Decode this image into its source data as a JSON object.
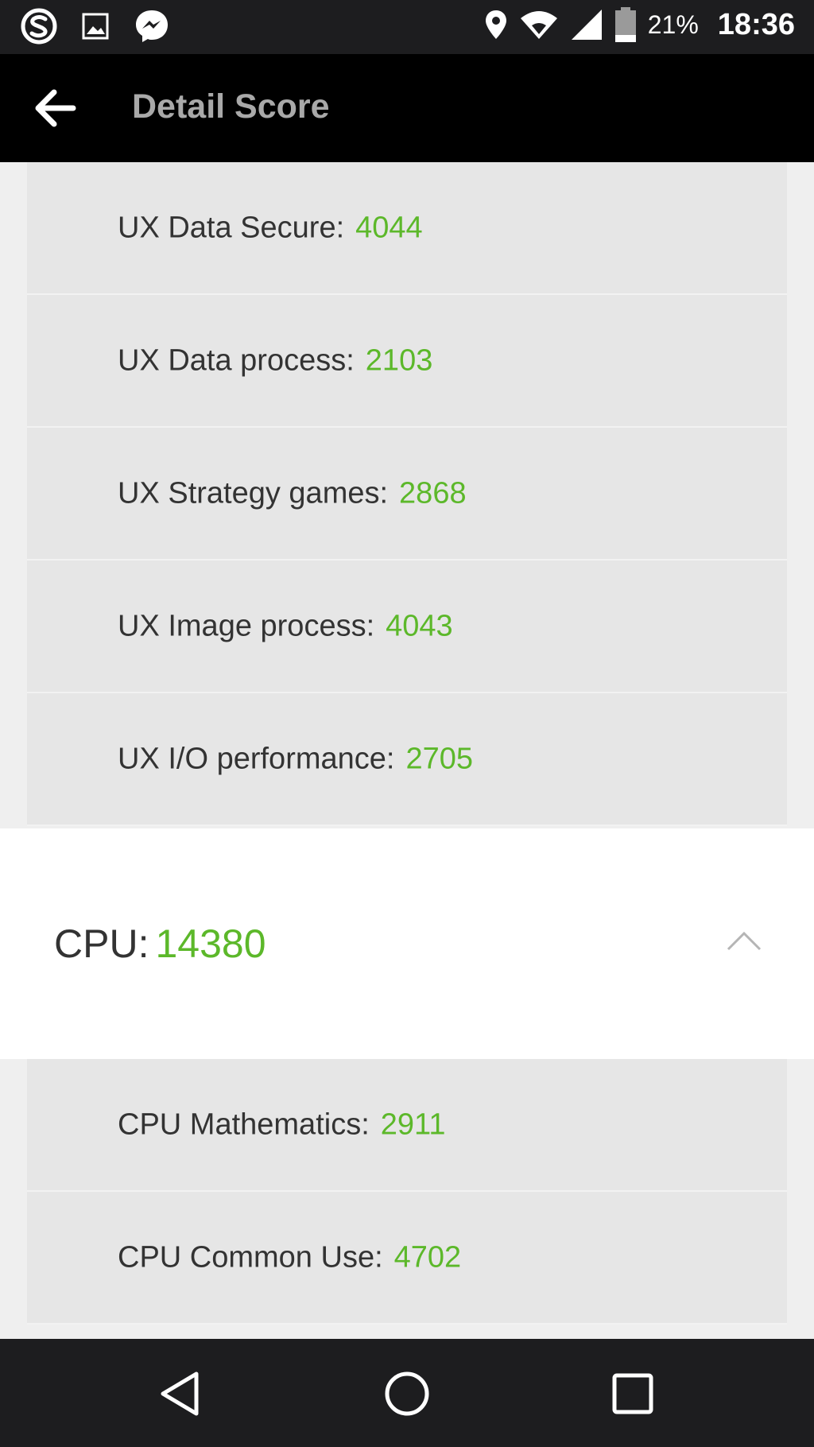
{
  "status_bar": {
    "battery_percent": "21%",
    "time": "18:36",
    "icons": [
      "s-app-icon",
      "gallery-icon",
      "messenger-icon",
      "location-icon",
      "wifi-icon",
      "signal-icon",
      "battery-icon"
    ]
  },
  "toolbar": {
    "title": "Detail Score",
    "back_icon": "back-arrow-icon"
  },
  "ux_items": [
    {
      "label": "UX Data Secure:",
      "score": "4044"
    },
    {
      "label": "UX Data process:",
      "score": "2103"
    },
    {
      "label": "UX Strategy games:",
      "score": "2868"
    },
    {
      "label": "UX Image process:",
      "score": "4043"
    },
    {
      "label": "UX I/O performance:",
      "score": "2705"
    }
  ],
  "cpu_group": {
    "label": "CPU:",
    "score": "14380",
    "toggle_icon": "chevron-up-icon"
  },
  "cpu_items": [
    {
      "label": "CPU Mathematics:",
      "score": "2911"
    },
    {
      "label": "CPU Common Use:",
      "score": "4702"
    }
  ],
  "nav_bar": {
    "icons": [
      "back-triangle-icon",
      "home-circle-icon",
      "recents-square-icon"
    ]
  },
  "colors": {
    "score_green": "#5cb82a",
    "toolbar_bg": "#000000",
    "status_bar_bg": "#1d1d1f",
    "item_bg": "#e6e6e6"
  }
}
